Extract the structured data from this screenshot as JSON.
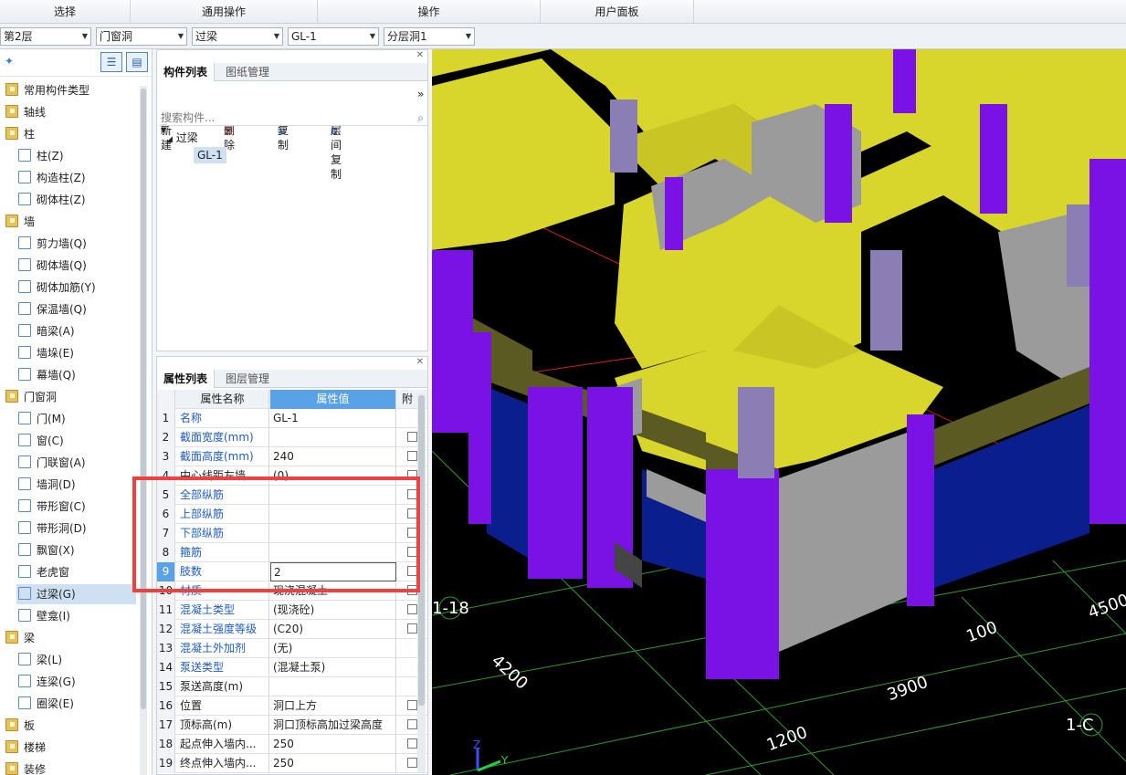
{
  "menu_tabs": [
    "选择",
    "通用操作",
    "操作",
    "用户面板"
  ],
  "toolbar": {
    "floor": "第2层",
    "category": "门窗洞",
    "type": "过梁",
    "component": "GL-1",
    "layer": "分层洞1"
  },
  "tree": [
    {
      "label": "常用构件类型",
      "kind": "folder"
    },
    {
      "label": "轴线",
      "kind": "folder"
    },
    {
      "label": "柱",
      "kind": "folder"
    },
    {
      "label": "柱(Z)",
      "kind": "sub"
    },
    {
      "label": "构造柱(Z)",
      "kind": "sub"
    },
    {
      "label": "砌体柱(Z)",
      "kind": "sub"
    },
    {
      "label": "墙",
      "kind": "folder"
    },
    {
      "label": "剪力墙(Q)",
      "kind": "sub"
    },
    {
      "label": "砌体墙(Q)",
      "kind": "sub"
    },
    {
      "label": "砌体加筋(Y)",
      "kind": "sub"
    },
    {
      "label": "保温墙(Q)",
      "kind": "sub"
    },
    {
      "label": "暗梁(A)",
      "kind": "sub"
    },
    {
      "label": "墙垛(E)",
      "kind": "sub"
    },
    {
      "label": "幕墙(Q)",
      "kind": "sub"
    },
    {
      "label": "门窗洞",
      "kind": "folder"
    },
    {
      "label": "门(M)",
      "kind": "sub"
    },
    {
      "label": "窗(C)",
      "kind": "sub"
    },
    {
      "label": "门联窗(A)",
      "kind": "sub"
    },
    {
      "label": "墙洞(D)",
      "kind": "sub"
    },
    {
      "label": "带形窗(C)",
      "kind": "sub"
    },
    {
      "label": "带形洞(D)",
      "kind": "sub"
    },
    {
      "label": "飘窗(X)",
      "kind": "sub"
    },
    {
      "label": "老虎窗",
      "kind": "sub"
    },
    {
      "label": "过梁(G)",
      "kind": "sub",
      "selected": true
    },
    {
      "label": "壁龛(I)",
      "kind": "sub"
    },
    {
      "label": "梁",
      "kind": "folder"
    },
    {
      "label": "梁(L)",
      "kind": "sub"
    },
    {
      "label": "连梁(G)",
      "kind": "sub"
    },
    {
      "label": "圈梁(E)",
      "kind": "sub"
    },
    {
      "label": "板",
      "kind": "folder"
    },
    {
      "label": "楼梯",
      "kind": "folder"
    },
    {
      "label": "装修",
      "kind": "folder"
    }
  ],
  "component_panel": {
    "tab_active": "构件列表",
    "tab_other": "图纸管理",
    "btn_new": "新建",
    "btn_delete": "删除",
    "btn_copy": "复制",
    "btn_floor_copy": "层间复制",
    "search_placeholder": "搜索构件...",
    "tree_root": "过梁",
    "tree_child": "GL-1"
  },
  "property_panel": {
    "tab_active": "属性列表",
    "tab_other": "图层管理",
    "col_name": "属性名称",
    "col_value": "属性值",
    "col_attach": "附",
    "rows": [
      {
        "n": "1",
        "name": "名称",
        "value": "GL-1",
        "blue": true,
        "check": false
      },
      {
        "n": "2",
        "name": "截面宽度(mm)",
        "value": "",
        "blue": true,
        "check": true
      },
      {
        "n": "3",
        "name": "截面高度(mm)",
        "value": "240",
        "blue": true,
        "check": true
      },
      {
        "n": "4",
        "name": "中心线距左墙...",
        "value": "(0)",
        "blue": false,
        "check": true
      },
      {
        "n": "5",
        "name": "全部纵筋",
        "value": "",
        "blue": true,
        "check": true
      },
      {
        "n": "6",
        "name": "上部纵筋",
        "value": "",
        "blue": true,
        "check": true
      },
      {
        "n": "7",
        "name": "下部纵筋",
        "value": "",
        "blue": true,
        "check": true
      },
      {
        "n": "8",
        "name": "箍筋",
        "value": "",
        "blue": true,
        "check": true
      },
      {
        "n": "9",
        "name": "肢数",
        "value": "2",
        "blue": true,
        "check": true
      },
      {
        "n": "10",
        "name": "材质",
        "value": "现浇混凝土",
        "blue": true,
        "check": true
      },
      {
        "n": "11",
        "name": "混凝土类型",
        "value": "(现浇砼)",
        "blue": true,
        "check": true
      },
      {
        "n": "12",
        "name": "混凝土强度等级",
        "value": "(C20)",
        "blue": true,
        "check": true
      },
      {
        "n": "13",
        "name": "混凝土外加剂",
        "value": "(无)",
        "blue": true,
        "check": false
      },
      {
        "n": "14",
        "name": "泵送类型",
        "value": "(混凝土泵)",
        "blue": true,
        "check": false
      },
      {
        "n": "15",
        "name": "泵送高度(m)",
        "value": "",
        "blue": false,
        "check": false
      },
      {
        "n": "16",
        "name": "位置",
        "value": "洞口上方",
        "blue": false,
        "check": true
      },
      {
        "n": "17",
        "name": "顶标高(m)",
        "value": "洞口顶标高加过梁高度",
        "blue": false,
        "check": true
      },
      {
        "n": "18",
        "name": "起点伸入墙内...",
        "value": "250",
        "blue": false,
        "check": true
      },
      {
        "n": "19",
        "name": "终点伸入墙内...",
        "value": "250",
        "blue": false,
        "check": true
      }
    ]
  },
  "viewport": {
    "dims": [
      "4500",
      "100",
      "3900",
      "4200",
      "1200"
    ],
    "axes": [
      "1-18",
      "1-C"
    ],
    "colors": {
      "wall": "#d9d62b",
      "column": "#7a12e6",
      "gray": "#9b9b9b",
      "beam": "#5a5a22",
      "glass": "#0a1f8c",
      "floor": "#000000",
      "grid": "#2e9a2e"
    }
  }
}
